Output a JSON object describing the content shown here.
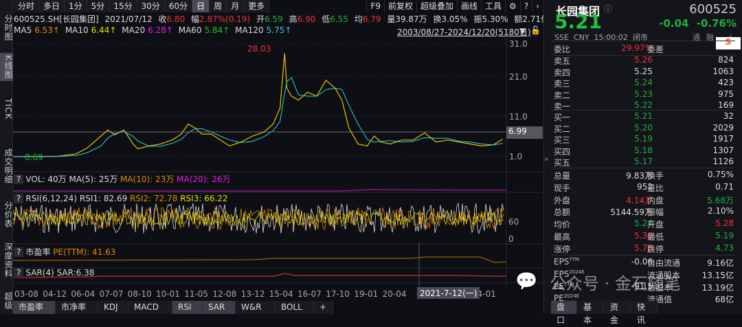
{
  "left_tabs": [
    "分时图",
    "K线图",
    "TICK",
    "成交明细",
    "分价表",
    "深度资料",
    "超级"
  ],
  "toolbar": {
    "periods": [
      "分时",
      "多日",
      "1分",
      "5分",
      "15分",
      "30分",
      "60分",
      "日",
      "周",
      "月",
      "更多"
    ],
    "right": [
      "F9",
      "前复权",
      "超级叠加",
      "画线",
      "工具"
    ]
  },
  "info": {
    "code": "600525.SH[长园集团]",
    "date": "2021/07/12",
    "close_l": "收",
    "close": "6.80",
    "chg_l": "幅",
    "chg": "2.87%(0.19)",
    "open_l": "开",
    "open": "6.59",
    "high_l": "高",
    "high": "6.90",
    "low_l": "低",
    "low": "6.55",
    "avg_l": "均",
    "avg": "6.79",
    "vol": "量39.87万",
    "turn": "换3.05%",
    "amp": "振5.30%",
    "amt": "额2.71亿"
  },
  "ma": {
    "ma5_l": "MA5",
    "ma5": "6.53↑",
    "ma10_l": "MA10",
    "ma10": "6.44↑",
    "ma20_l": "MA20",
    "ma20": "6.28↑",
    "ma60_l": "MA60",
    "ma60": "5.84↑",
    "ma120_l": "MA120",
    "ma120": "5.75↑"
  },
  "range": "2003/08/27-2024/12/20(5180日)",
  "chart_data": {
    "type": "line",
    "title": "600525.SH 日K",
    "yticks": [
      "31.0",
      "21.0",
      "11.0",
      "1.0"
    ],
    "ytick_values": [
      31,
      21,
      11,
      1
    ],
    "crosshair": "6.99",
    "max_label": "28.03",
    "min_label": "0.69",
    "x": [
      2003.6,
      2004.5,
      2005.5,
      2006.3,
      2006.8,
      2007.4,
      2007.7,
      2008.0,
      2008.4,
      2008.8,
      2009.0,
      2009.5,
      2010.0,
      2010.5,
      2010.9,
      2011.2,
      2011.5,
      2011.8,
      2012.2,
      2012.6,
      2013.0,
      2013.5,
      2014.0,
      2014.5,
      2014.9,
      2015.2,
      2015.4,
      2015.5,
      2015.7,
      2016.0,
      2016.4,
      2016.8,
      2017.2,
      2017.6,
      2017.9,
      2018.2,
      2018.6,
      2019.0,
      2019.3,
      2019.6,
      2020.0,
      2020.5,
      2021.0,
      2021.5,
      2022.0,
      2022.5,
      2023.0,
      2023.5,
      2024.0,
      2024.5,
      2024.9
    ],
    "close": [
      0.8,
      0.9,
      0.9,
      1.5,
      3,
      6,
      7.5,
      6.3,
      7.5,
      4,
      2.8,
      3.5,
      4,
      5,
      6.5,
      9,
      8,
      6.5,
      6.5,
      5,
      3.5,
      4.5,
      6,
      7,
      9,
      13,
      28,
      18,
      16,
      15,
      17,
      16,
      20,
      18,
      15,
      8,
      4,
      3.5,
      6,
      4.5,
      4,
      5,
      5,
      6.8,
      4.5,
      5,
      4.5,
      4,
      3.5,
      3.8,
      5.2
    ],
    "xticks": [
      "03-08",
      "04-12",
      "06-04",
      "07-07",
      "08-10",
      "10-01",
      "11-05",
      "12-08",
      "13-12",
      "15-04",
      "16-07",
      "17-10",
      "19-01",
      "20-04",
      "24-01"
    ],
    "cursor_date": "2021-7-12(一)"
  },
  "vol": {
    "q": "?",
    "label": "VOL: 40万",
    "ma5": "MA(5): 25万",
    "ma10": "MA(10): 23万",
    "ma20": "MA(20): 26万"
  },
  "rsi": {
    "q": "?",
    "label": "RSI(6,12,24)",
    "rsi1": "RSI1: 82.69",
    "rsi2": "RSI2: 72.78",
    "rsi3": "RSI3: 66.22",
    "ticks": [
      "60",
      "0"
    ]
  },
  "pe": {
    "q": "?",
    "label": "市盈率",
    "value": "PE(TTM): 41.63"
  },
  "sar": {
    "q": "?",
    "label": "SAR(4)",
    "value": "SAR:6.38"
  },
  "bottom_tabs": [
    "市盈率",
    "市净率",
    "KDJ",
    "MACD",
    "RSI",
    "SAR",
    "W&R",
    "BOLL",
    "+"
  ],
  "right": {
    "name": "长园集团",
    "code": "600525",
    "price": "5.21",
    "change": "-0.04",
    "pct": "-0.76%",
    "meta": "SSE  CNY  15:00:02  闭市",
    "tong": "通",
    "rong": "融",
    "weibi_l": "委比",
    "weibi": "29.97%",
    "weicha_l": "委差",
    "asks": [
      {
        "l": "卖五",
        "p": "5.26",
        "v": "824",
        "c": "r"
      },
      {
        "l": "卖四",
        "p": "5.25",
        "v": "1063",
        "c": "w"
      },
      {
        "l": "卖三",
        "p": "5.24",
        "v": "423",
        "c": "g"
      },
      {
        "l": "卖二",
        "p": "5.23",
        "v": "975",
        "c": "g"
      },
      {
        "l": "卖一",
        "p": "5.22",
        "v": "169",
        "c": "g"
      }
    ],
    "bids": [
      {
        "l": "买一",
        "p": "5.21",
        "v": "32",
        "c": "g"
      },
      {
        "l": "买二",
        "p": "5.20",
        "v": "2029",
        "c": "g"
      },
      {
        "l": "买三",
        "p": "5.19",
        "v": "1917",
        "c": "g"
      },
      {
        "l": "买四",
        "p": "5.18",
        "v": "1307",
        "c": "g"
      },
      {
        "l": "买五",
        "p": "5.17",
        "v": "1126",
        "c": "g"
      }
    ],
    "stats": [
      {
        "a": "总量",
        "b": "9.83万",
        "bc": "w",
        "c": "换手",
        "d": "0.75%",
        "dc": "w"
      },
      {
        "a": "现手",
        "b": "952",
        "bc": "w",
        "c": "量比",
        "d": "0.71",
        "dc": "w"
      },
      {
        "a": "外盘",
        "b": "4.14万",
        "bc": "r",
        "c": "内盘",
        "d": "5.68万",
        "dc": "g"
      },
      {
        "a": "总额",
        "b": "5144.59万",
        "bc": "w",
        "c": "振幅",
        "d": "2.10%",
        "dc": "w"
      },
      {
        "a": "均价",
        "b": "5.24",
        "bc": "g",
        "c": "开盘",
        "d": "5.28",
        "dc": "r"
      },
      {
        "a": "最高",
        "b": "5.30",
        "bc": "r",
        "c": "最低",
        "d": "5.19",
        "dc": "g"
      },
      {
        "a": "涨停",
        "b": "5.78",
        "bc": "r",
        "c": "跌停",
        "d": "4.73",
        "dc": "g"
      }
    ],
    "fin": [
      {
        "a": "EPS TTM",
        "b": "-0.06",
        "c": "自由流通",
        "d": "9.16亿"
      },
      {
        "a": "EPS 2024E",
        "b": "",
        "c": "流通股本",
        "d": "13.15亿"
      },
      {
        "a": "PE TTM",
        "b": "-91.5",
        "c": "总股本",
        "d": "13.19亿"
      },
      {
        "a": "PE 2024E",
        "b": "",
        "c": "流通值",
        "d": "68亿"
      }
    ],
    "tabs": [
      "盘口",
      "基本",
      "资金",
      "快讯"
    ]
  },
  "watermark": "公众号 · 金石随笔"
}
